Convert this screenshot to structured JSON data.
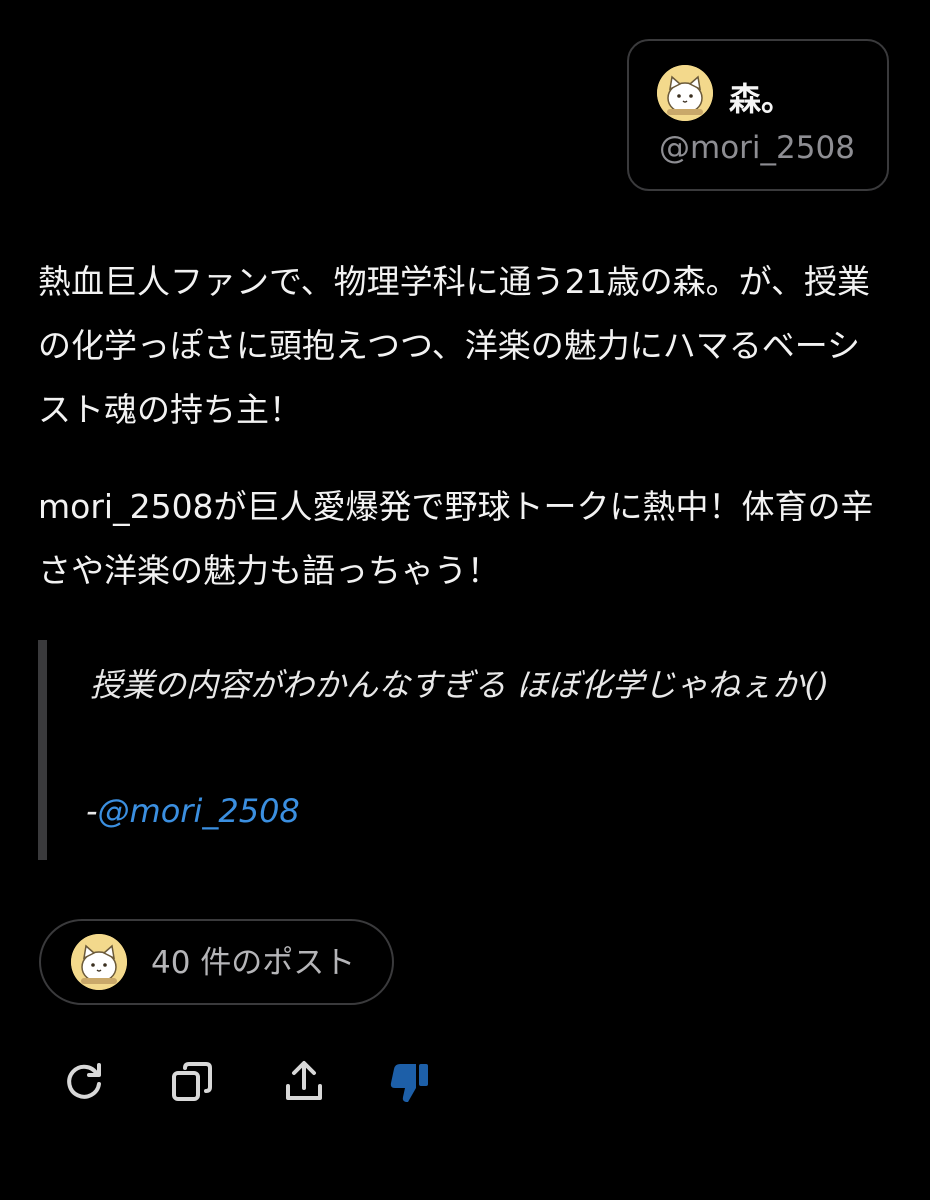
{
  "profile": {
    "display_name": "森。",
    "handle": "@mori_2508",
    "avatar_icon": "cat-avatar-icon",
    "avatar_bg": "#f3d98c"
  },
  "description": {
    "paragraph1": "熱血巨人ファンで、物理学科に通う21歳の森。が、授業の化学っぽさに頭抱えつつ、洋楽の魅力にハマるベーシスト魂の持ち主！",
    "paragraph2": "mori_2508が巨人愛爆発で野球トークに熱中！体育の辛さや洋楽の魅力も語っちゃう！"
  },
  "quote": {
    "text": "授業の内容がわかんなすぎる ほぼ化学じゃねぇか()",
    "attribution_prefix": "-",
    "attribution_link": "@mori_2508"
  },
  "posts_button": {
    "label": "40 件のポスト"
  },
  "actions": [
    {
      "name": "refresh-icon",
      "color": "#d8d8d8"
    },
    {
      "name": "copy-icon",
      "color": "#d8d8d8"
    },
    {
      "name": "share-icon",
      "color": "#d8d8d8"
    },
    {
      "name": "thumbs-down-icon",
      "color": "#1d5fa8"
    }
  ],
  "colors": {
    "background": "#000000",
    "text": "#f2f2f2",
    "muted": "#8e8e93",
    "link": "#3b8fe0",
    "border": "#3a3a3c"
  }
}
